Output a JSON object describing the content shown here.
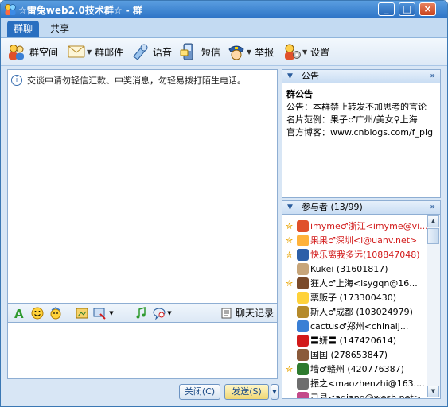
{
  "window": {
    "title": "☆雷兔web2.0技术群☆ - 群",
    "controls": {
      "minimize": "_",
      "maximize": "□",
      "close": "×"
    }
  },
  "tabs": [
    {
      "label": "群聊"
    },
    {
      "label": "共享"
    }
  ],
  "toolbar": {
    "group_space": "群空间",
    "group_mail": "群邮件",
    "voice": "语音",
    "sms": "短信",
    "report": "举报",
    "settings": "设置"
  },
  "chat": {
    "system_message": "交谈中请勿轻信汇款、中奖消息，勿轻易拨打陌生电话。"
  },
  "format_bar": {
    "history": "聊天记录"
  },
  "actions": {
    "close": "关闭(C)",
    "send": "发送(S)"
  },
  "announcement": {
    "header": "公告",
    "title": "群公告",
    "body": "公告：本群禁止转发不加思考的言论",
    "card_example": "名片范例：果子♂广州/美女♀上海",
    "blog": "官方博客：www.cnblogs.com/f_pig"
  },
  "members": {
    "header": "参与者 (13/99)",
    "list": [
      {
        "name": "imyme♂浙江<imyme@vi...",
        "admin": true,
        "color": "#d21a1a"
      },
      {
        "name": "果果♂深圳<i@uanv.net>",
        "admin": true,
        "color": "#d21a1a"
      },
      {
        "name": "快乐离我多远(108847048)",
        "admin": true,
        "color": "#d21a1a"
      },
      {
        "name": "Kukei (31601817)",
        "admin": false,
        "color": "#000000"
      },
      {
        "name": "狂人♂上海<isygqn@16...",
        "admin": true,
        "color": "#000000"
      },
      {
        "name": "票贩子 (173300430)",
        "admin": false,
        "color": "#000000"
      },
      {
        "name": "斯人♂成都 (103024979)",
        "admin": false,
        "color": "#000000"
      },
      {
        "name": "cactus♂郑州<chinalj...",
        "admin": false,
        "color": "#000000"
      },
      {
        "name": "〓妍〓 (147420614)",
        "admin": false,
        "color": "#000000"
      },
      {
        "name": "国国 (278653847)",
        "admin": false,
        "color": "#000000"
      },
      {
        "name": "墙♂赣州 (420776387)",
        "admin": true,
        "color": "#000000"
      },
      {
        "name": "振之<maozhenzhi@163....",
        "admin": false,
        "color": "#000000"
      },
      {
        "name": "己易<agiang@wesh.net>",
        "admin": false,
        "color": "#000000"
      }
    ]
  },
  "colors": {
    "titlebar": "#2d73c6",
    "admin_star": "#e8a400",
    "admin_name": "#d21a1a"
  }
}
